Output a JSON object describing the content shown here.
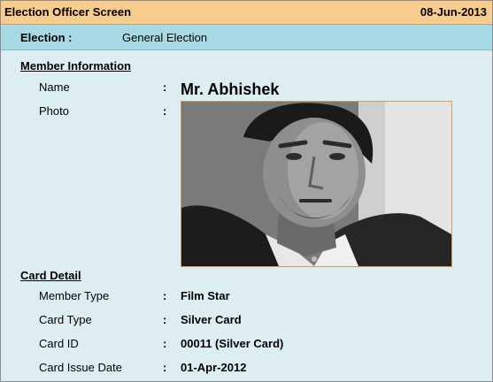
{
  "window": {
    "title": "Election Officer Screen",
    "date": "08-Jun-2013"
  },
  "election": {
    "label": "Election :",
    "value": "General Election"
  },
  "member_info": {
    "heading": "Member Information",
    "name_label": "Name",
    "name_value": "Mr. Abhishek",
    "photo_label": "Photo"
  },
  "card_detail": {
    "heading": "Card Detail",
    "rows": [
      {
        "label": "Member Type",
        "value": "Film Star"
      },
      {
        "label": "Card Type",
        "value": "Silver Card"
      },
      {
        "label": "Card ID",
        "value": "00011 (Silver Card)"
      },
      {
        "label": "Card Issue Date",
        "value": "01-Apr-2012"
      }
    ]
  },
  "colon": ":",
  "colors": {
    "titlebar": "#f8cc8c",
    "election_bar": "#a8dae6",
    "body_bg": "#ddeef2",
    "photo_border": "#d99a55"
  }
}
